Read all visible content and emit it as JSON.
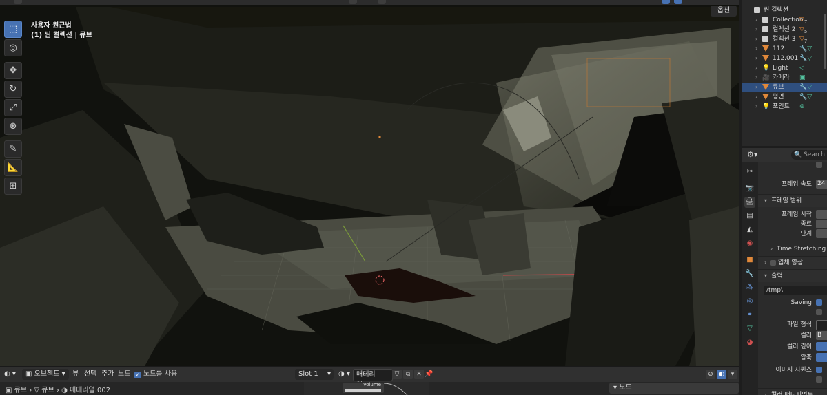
{
  "viewport": {
    "view_name": "사용자 원근법",
    "view_subtitle": "(1) 씬 컬렉션 | 큐브",
    "options_label": "옵션"
  },
  "tools": [
    {
      "name": "select-box-tool",
      "glyph": "⬚",
      "active": true
    },
    {
      "name": "cursor-tool",
      "glyph": "◎",
      "active": false
    },
    {
      "name": "move-tool",
      "glyph": "✥",
      "active": false
    },
    {
      "name": "rotate-tool",
      "glyph": "↻",
      "active": false
    },
    {
      "name": "scale-tool",
      "glyph": "⤢",
      "active": false
    },
    {
      "name": "transform-tool",
      "glyph": "⊕",
      "active": false
    },
    {
      "name": "annotate-tool",
      "glyph": "✎",
      "active": false
    },
    {
      "name": "measure-tool",
      "glyph": "📐",
      "active": false
    },
    {
      "name": "add-cube-tool",
      "glyph": "⊞",
      "active": false
    }
  ],
  "vp_header": {
    "mode": "오브젝트",
    "menu_view": "뷰",
    "menu_select": "선택",
    "menu_add": "추가",
    "menu_node": "노드",
    "use_nodes_label": "노드를 사용",
    "slot": "Slot 1",
    "material_name": "매테리얼.002"
  },
  "breadcrumb": {
    "item1": "큐브",
    "item2": "큐브",
    "item3": "매테리얼.002"
  },
  "node_editor": {
    "volume_label": "Volume",
    "panel_title": "노드"
  },
  "outliner": {
    "scene_collection": "씬 컬렉션",
    "items": [
      {
        "label": "Collection",
        "extra": "7"
      },
      {
        "label": "컬렉션 2",
        "extra": "5"
      },
      {
        "label": "컬렉션 3",
        "extra": "7"
      },
      {
        "label": "112",
        "extra": ""
      },
      {
        "label": "112.001",
        "extra": ""
      },
      {
        "label": "Light",
        "extra": ""
      },
      {
        "label": "카메라",
        "extra": ""
      },
      {
        "label": "큐브",
        "extra": ""
      },
      {
        "label": "평면",
        "extra": ""
      },
      {
        "label": "포인트",
        "extra": ""
      }
    ]
  },
  "properties": {
    "search_placeholder": "Search",
    "frame_rate_label": "프레임 속도",
    "frame_rate_value": "24",
    "frame_range_section": "프레임 범위",
    "frame_start_label": "프레임 시작",
    "frame_end_label": "종료",
    "frame_step_label": "단계",
    "time_stretching": "Time Stretching",
    "stereoscopy": "입체 영상",
    "output_section": "출력",
    "output_path": "/tmp\\",
    "saving_label": "Saving",
    "file_format_label": "파일 형식",
    "color_label": "컬러",
    "color_value": "B",
    "color_depth_label": "컬러 깊이",
    "compression_label": "압축",
    "image_sequence_label": "이미지 시퀀스",
    "color_management": "컬러 매니지먼트"
  },
  "colors": {
    "accent": "#4772b3",
    "object_orange": "#e0883a",
    "data_green": "#54c29f"
  }
}
